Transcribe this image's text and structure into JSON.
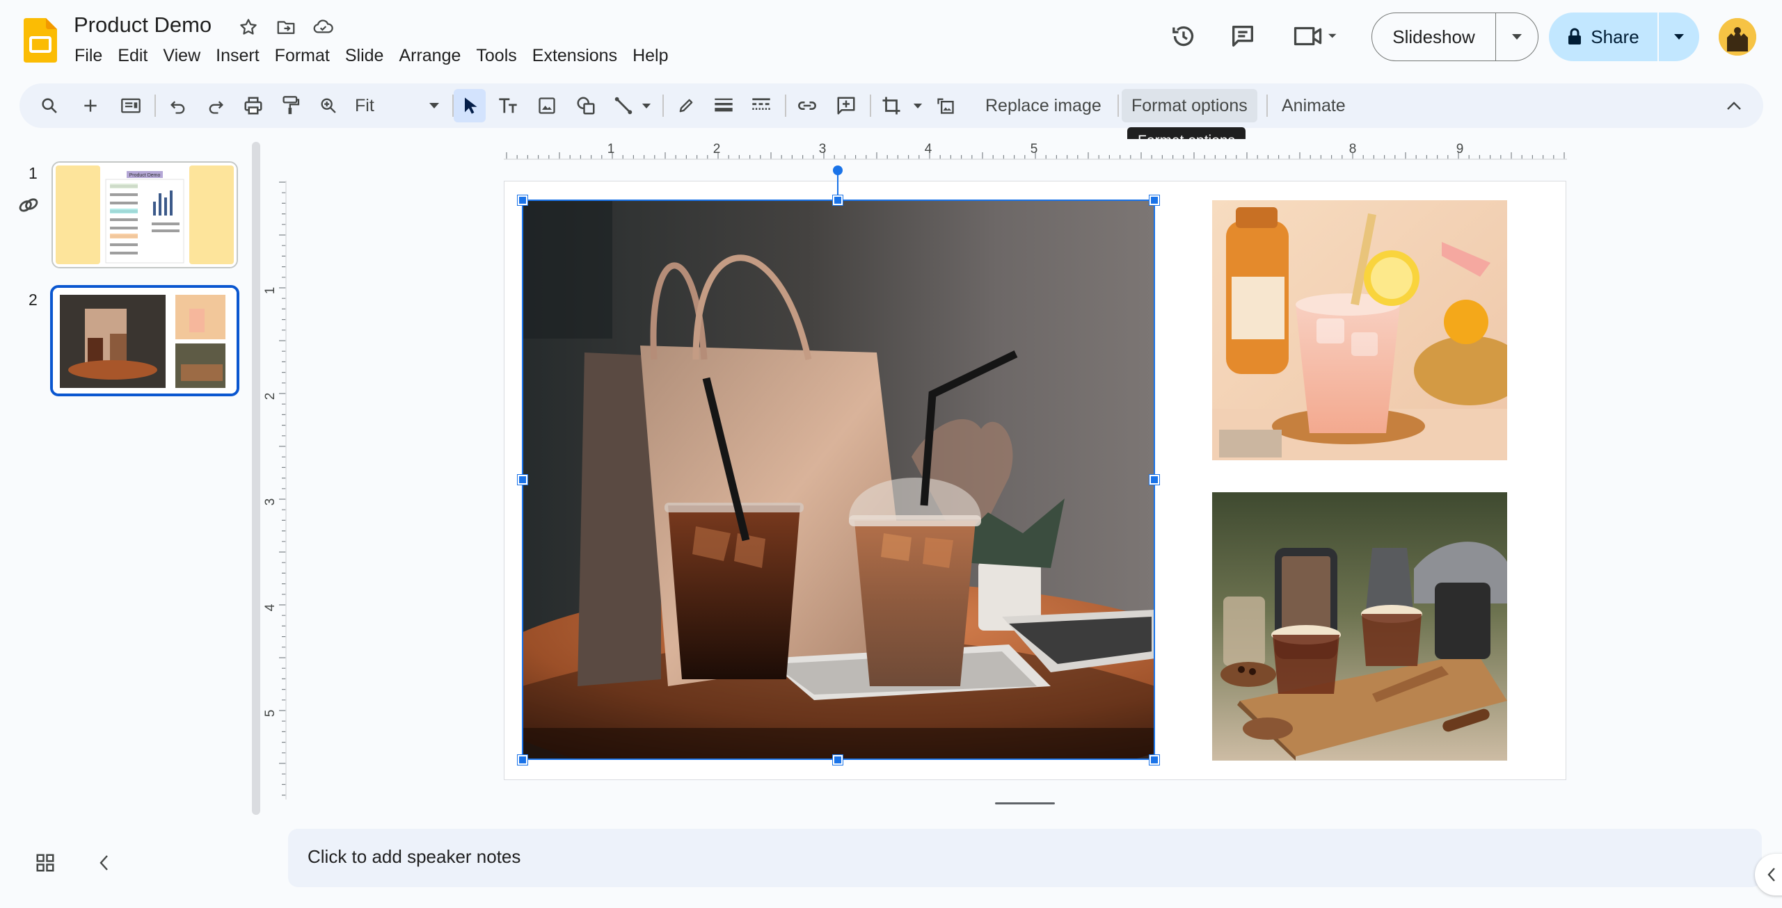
{
  "doc": {
    "title": "Product Demo"
  },
  "menu": [
    "File",
    "Edit",
    "View",
    "Insert",
    "Format",
    "Slide",
    "Arrange",
    "Tools",
    "Extensions",
    "Help"
  ],
  "header": {
    "slideshow_label": "Slideshow",
    "share_label": "Share"
  },
  "toolbar": {
    "zoom_value": "Fit",
    "replace_image_label": "Replace image",
    "format_options_label": "Format options",
    "animate_label": "Animate"
  },
  "tooltip": "Format options",
  "ruler": {
    "horizontal_labels": [
      "1",
      "2",
      "3",
      "4",
      "5",
      "8",
      "9"
    ],
    "vertical_labels": [
      "1",
      "2",
      "3",
      "4",
      "5"
    ]
  },
  "filmstrip": {
    "slides": [
      {
        "number": "1",
        "selected": false,
        "thumb_title": "Product Demo"
      },
      {
        "number": "2",
        "selected": true
      }
    ]
  },
  "notes": {
    "placeholder": "Click to add speaker notes"
  },
  "colors": {
    "accent": "#0b57d0",
    "selection": "#1a73e8",
    "share_bg": "#c2e7ff",
    "toolbar_bg": "#edf2fa",
    "logo": "#fbbc04"
  }
}
